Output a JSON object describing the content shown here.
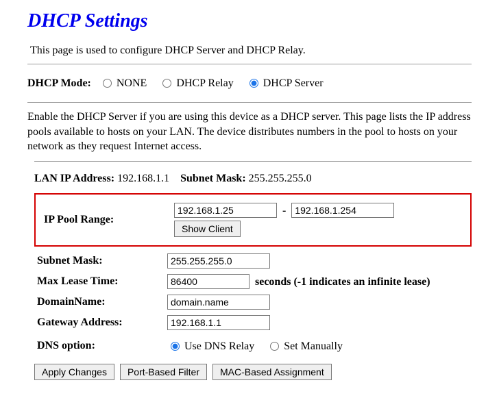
{
  "page": {
    "title": "DHCP Settings",
    "intro": "This page is used to configure DHCP Server and DHCP Relay."
  },
  "mode": {
    "label": "DHCP Mode:",
    "options": {
      "none": "NONE",
      "relay": "DHCP Relay",
      "server": "DHCP Server"
    },
    "selected": "server"
  },
  "description": "Enable the DHCP Server if you are using this device as a DHCP server. This page lists the IP address pools available to hosts on your LAN. The device distributes numbers in the pool to hosts on your network as they request Internet access.",
  "lan": {
    "ip_label": "LAN IP Address:",
    "ip_value": "192.168.1.1",
    "mask_label": "Subnet Mask:",
    "mask_value": "255.255.255.0"
  },
  "pool": {
    "label": "IP Pool Range:",
    "start": "192.168.1.25",
    "end": "192.168.1.254",
    "show_client_btn": "Show Client"
  },
  "fields": {
    "subnet": {
      "label": "Subnet Mask:",
      "value": "255.255.255.0"
    },
    "lease": {
      "label": "Max Lease Time:",
      "value": "86400",
      "note": "seconds (-1 indicates an infinite lease)"
    },
    "domain": {
      "label": "DomainName:",
      "value": "domain.name"
    },
    "gateway": {
      "label": "Gateway Address:",
      "value": "192.168.1.1"
    }
  },
  "dns": {
    "label": "DNS option:",
    "use_relay": "Use DNS Relay",
    "set_manually": "Set Manually",
    "selected": "relay"
  },
  "buttons": {
    "apply": "Apply Changes",
    "port_filter": "Port-Based Filter",
    "mac_assign": "MAC-Based Assignment"
  }
}
